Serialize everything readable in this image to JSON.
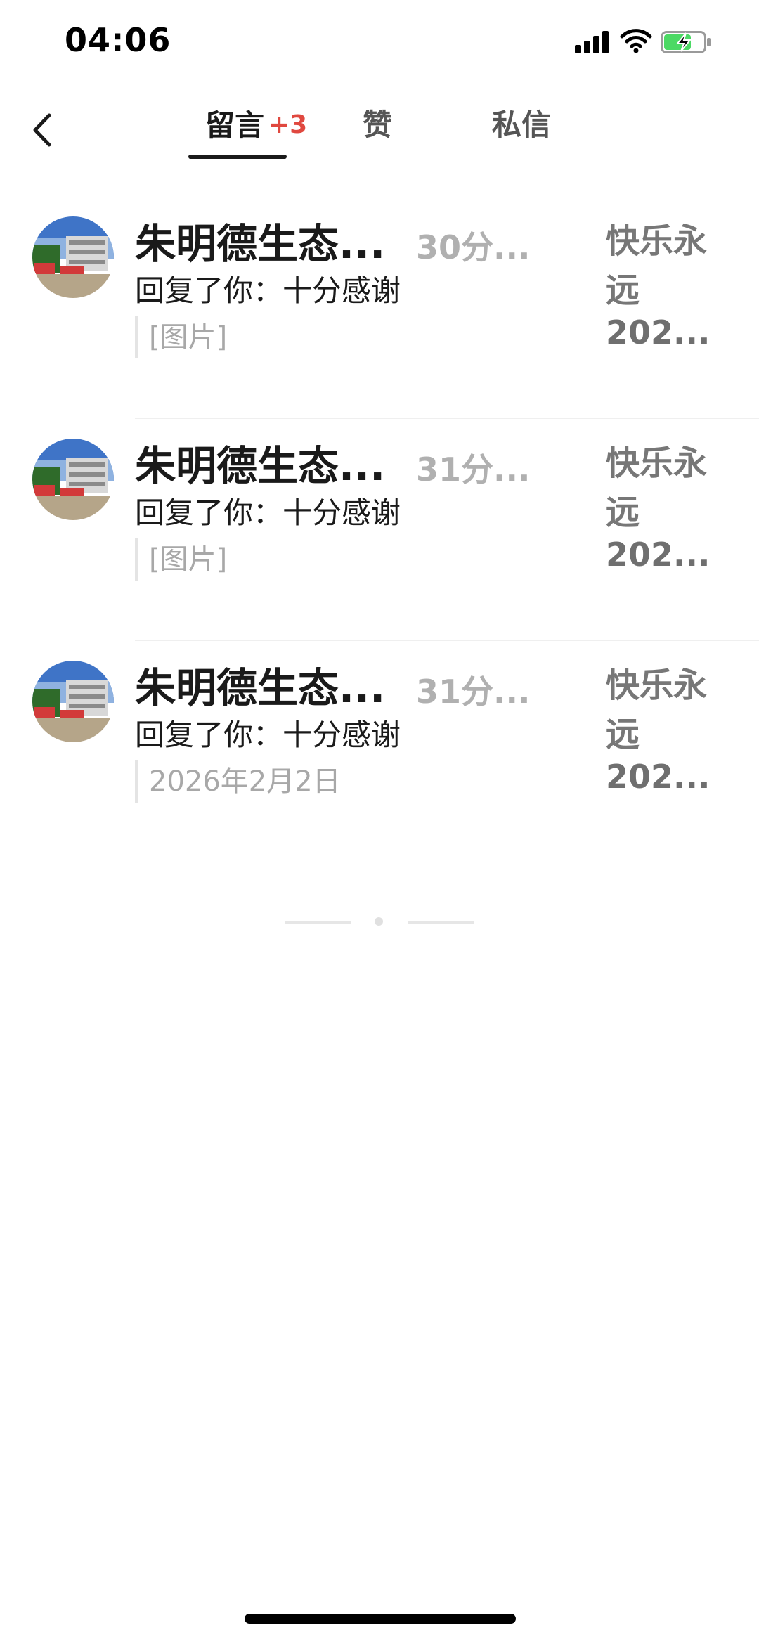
{
  "status_bar": {
    "time": "04:06",
    "icons": [
      "cellular-signal-icon",
      "wifi-icon",
      "battery-charging-icon"
    ]
  },
  "header": {
    "back_icon": "chevron-left-icon",
    "tabs": [
      {
        "label": "留言",
        "badge": "+3",
        "active": true
      },
      {
        "label": "赞",
        "active": false
      },
      {
        "label": "私信",
        "active": false
      }
    ]
  },
  "messages": [
    {
      "name": "朱明德生态...",
      "time": "30分...",
      "text": "回复了你：十分感谢",
      "quote": "[图片]",
      "post_title": "快乐永远",
      "post_sub": "202..."
    },
    {
      "name": "朱明德生态...",
      "time": "31分...",
      "text": "回复了你：十分感谢",
      "quote": "[图片]",
      "post_title": "快乐永远",
      "post_sub": "202..."
    },
    {
      "name": "朱明德生态...",
      "time": "31分...",
      "text": "回复了你：十分感谢",
      "quote": "2026年2月2日",
      "post_title": "快乐永远",
      "post_sub": "202..."
    }
  ],
  "colors": {
    "badge": "#e0483f",
    "muted": "#a8a8a8",
    "text": "#1a1a1a"
  }
}
